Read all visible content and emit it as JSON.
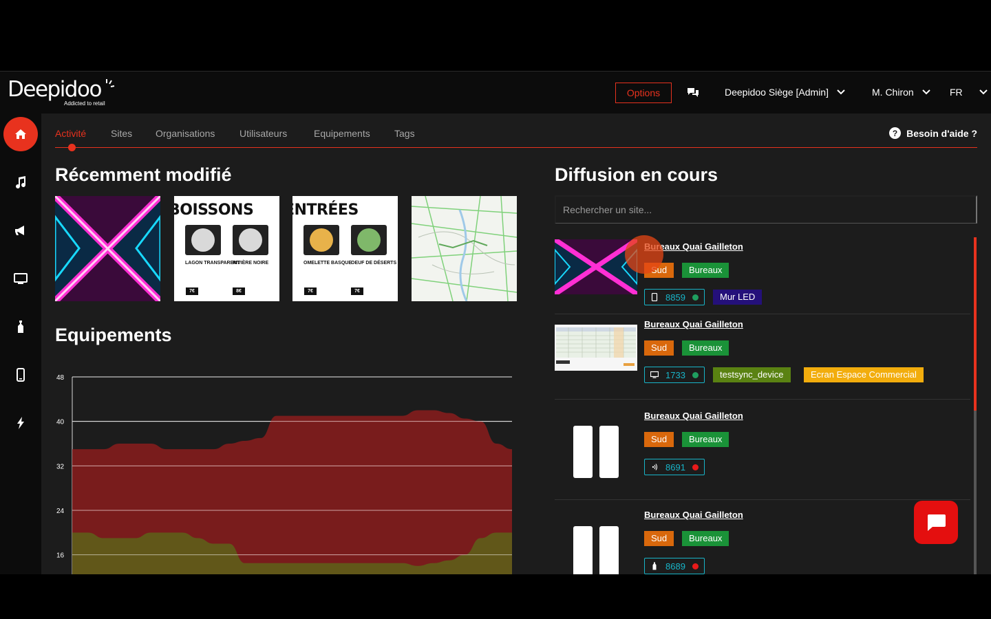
{
  "header": {
    "logo": "Deepidoo",
    "logo_tagline": "Addicted to retail",
    "options_label": "Options",
    "organization": "Deepidoo Siège [Admin]",
    "user": "M. Chiron",
    "language": "FR"
  },
  "sidebar": {
    "items": [
      {
        "name": "home",
        "active": true
      },
      {
        "name": "music"
      },
      {
        "name": "announcements"
      },
      {
        "name": "screens"
      },
      {
        "name": "bottle"
      },
      {
        "name": "mobile"
      },
      {
        "name": "energy"
      }
    ]
  },
  "tabs": {
    "items": [
      "Activité",
      "Sites",
      "Organisations",
      "Utilisateurs",
      "Equipements",
      "Tags"
    ],
    "active": "Activité",
    "help_label": "Besoin d'aide ?"
  },
  "recent": {
    "title": "Récemment modifié",
    "thumbs": [
      {
        "kind": "neon"
      },
      {
        "kind": "menu",
        "title": "BOISSONS",
        "items": [
          "LAGON TRANSPARENT",
          "RIVIÈRE NOIRE"
        ],
        "prices": [
          "7€",
          "8€"
        ]
      },
      {
        "kind": "menu",
        "title": "ENTRÉES",
        "items": [
          "OMELETTE BASQUE",
          "OEUF DE DÉSERTS"
        ],
        "prices": [
          "7€",
          "7€"
        ]
      },
      {
        "kind": "map"
      }
    ]
  },
  "equipements": {
    "title": "Equipements"
  },
  "chart_data": {
    "type": "area",
    "title": "",
    "xlabel": "",
    "ylabel": "",
    "ylim": [
      12,
      48
    ],
    "yticks": [
      48,
      40,
      32,
      24,
      16
    ],
    "grid": true,
    "series": [
      {
        "color": "#8a1c1c",
        "values": [
          35,
          35,
          35,
          36,
          36,
          36,
          35,
          35,
          35,
          35,
          36,
          36.5,
          37,
          41,
          41,
          41,
          41,
          41,
          41,
          41,
          41,
          41,
          42,
          42,
          41.5,
          40.5,
          40,
          36,
          35
        ]
      },
      {
        "color": "#5e5e1a",
        "values": [
          20,
          20,
          19,
          19,
          19,
          20,
          20,
          20,
          19,
          18,
          18,
          14.5,
          14.5,
          14.5,
          14.5,
          14.5,
          14.5,
          14.5,
          14.5,
          14.5,
          14.5,
          14.5,
          14,
          14.5,
          15,
          16,
          19,
          20,
          20
        ]
      }
    ]
  },
  "diffusion": {
    "title": "Diffusion en cours",
    "search_placeholder": "Rechercher un site...",
    "items": [
      {
        "site": "Bureaux Quai Gailleton",
        "tags": [
          "Sud",
          "Bureaux"
        ],
        "device_icon": "tablet-icon",
        "device_id": "8859",
        "status": "online",
        "extra": [
          {
            "label": "Mur LED",
            "color": "navy"
          }
        ],
        "thumb": "neon"
      },
      {
        "site": "Bureaux Quai Gailleton",
        "tags": [
          "Sud",
          "Bureaux"
        ],
        "device_icon": "monitor-icon",
        "device_id": "1733",
        "status": "online",
        "extra": [
          {
            "label": "testsync_device",
            "color": "olive"
          },
          {
            "label": "Ecran Espace Commercial",
            "color": "yellow"
          }
        ],
        "thumb": "spreadsheet"
      },
      {
        "site": "Bureaux Quai Gailleton",
        "tags": [
          "Sud",
          "Bureaux"
        ],
        "device_icon": "speaker-icon",
        "device_id": "8691",
        "status": "offline",
        "extra": [],
        "thumb": "pause"
      },
      {
        "site": "Bureaux Quai Gailleton",
        "tags": [
          "Sud",
          "Bureaux"
        ],
        "device_icon": "bottle-icon",
        "device_id": "8689",
        "status": "offline",
        "extra": [],
        "thumb": "pause"
      }
    ]
  },
  "colors": {
    "accent": "#e8321e",
    "background": "#1c1c1c",
    "panel": "#0c0c0c",
    "device": "#18b5c9"
  }
}
